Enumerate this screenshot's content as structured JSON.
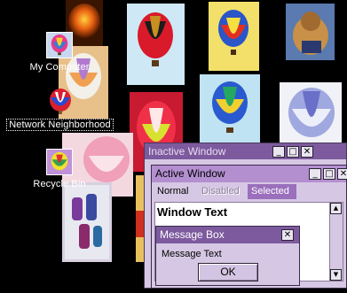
{
  "colors": {
    "desktop": "#000000",
    "inactive_title": "#7d5a9e",
    "active_title": "#b38fd0",
    "window_face": "#d6c8e4",
    "selected_bg": "#9a6fbc"
  },
  "desktop_icons": [
    {
      "label": "My Computer",
      "icon": "balloon-icon"
    },
    {
      "label": "Network Neighborhood",
      "icon": "balloon-icon"
    },
    {
      "label": "Recycle Bin",
      "icon": "balloon-icon"
    }
  ],
  "inactive_window": {
    "title": "Inactive Window",
    "buttons": [
      "_",
      "□",
      "✕"
    ]
  },
  "active_window": {
    "title": "Active Window",
    "buttons": [
      "_",
      "□",
      "✕"
    ],
    "menu": {
      "normal": "Normal",
      "disabled": "Disabled",
      "selected": "Selected"
    },
    "body_text": "Window Text",
    "scroll_up": "▲",
    "scroll_down": "▼"
  },
  "message_box": {
    "title": "Message Box",
    "close": "✕",
    "text": "Message Text",
    "ok_label": "OK"
  }
}
